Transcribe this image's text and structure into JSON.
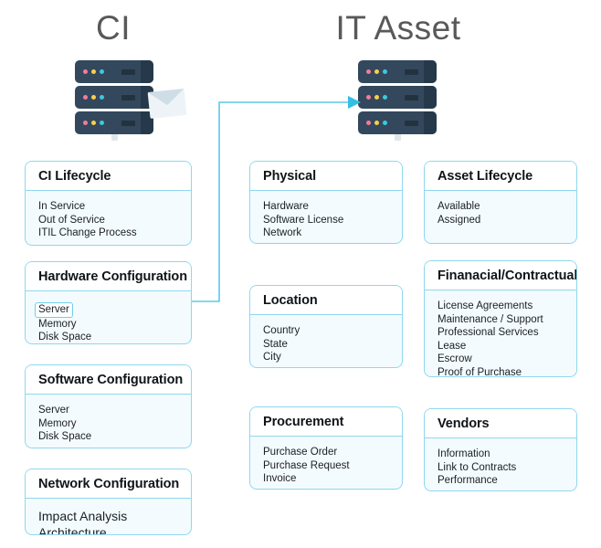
{
  "headings": {
    "left": "CI",
    "right": "IT Asset"
  },
  "icons": {
    "server_ci": "server-stack-icon",
    "server_asset": "server-stack-icon",
    "envelope": "envelope-icon",
    "arrow": "arrow-right-icon"
  },
  "colors": {
    "panel_border": "#8fd7ee",
    "panel_body_bg": "#f4fbfe",
    "panel_head_bg": "#ffffff",
    "connector": "#5bc8e8",
    "heading_text": "#58595b",
    "server_body": "#33485c",
    "server_side": "#25394a",
    "dot_pink": "#f47b9b",
    "dot_yellow": "#f7cf4a",
    "dot_cyan": "#3dc8e0"
  },
  "panels": {
    "ci_lifecycle": {
      "title": "CI Lifecycle",
      "items": [
        "In Service",
        "Out of Service",
        "ITIL Change Process"
      ]
    },
    "hardware_configuration": {
      "title": "Hardware Configuration",
      "items": [
        "Server",
        "Memory",
        "Disk Space"
      ],
      "highlighted_item": "Server"
    },
    "software_configuration": {
      "title": "Software Configuration",
      "items": [
        "Server",
        "Memory",
        "Disk Space"
      ]
    },
    "network_configuration": {
      "title": "Network Configuration",
      "items": [
        "Impact Analysis",
        "Architecture"
      ]
    },
    "physical": {
      "title": "Physical",
      "items": [
        "Hardware",
        "Software License",
        "Network"
      ]
    },
    "location": {
      "title": "Location",
      "items": [
        "Country",
        "State",
        "City"
      ]
    },
    "procurement": {
      "title": "Procurement",
      "items": [
        "Purchase Order",
        "Purchase Request",
        "Invoice"
      ]
    },
    "asset_lifecycle": {
      "title": "Asset Lifecycle",
      "items": [
        "Available",
        "Assigned"
      ]
    },
    "financial_contractual": {
      "title": "Finanacial/Contractual",
      "items": [
        "License Agreements",
        "Maintenance / Support",
        "Professional Services",
        "Lease",
        "Escrow",
        "Proof of Purchase"
      ]
    },
    "vendors": {
      "title": "Vendors",
      "items": [
        "Information",
        "Link to Contracts",
        "Performance"
      ]
    }
  }
}
